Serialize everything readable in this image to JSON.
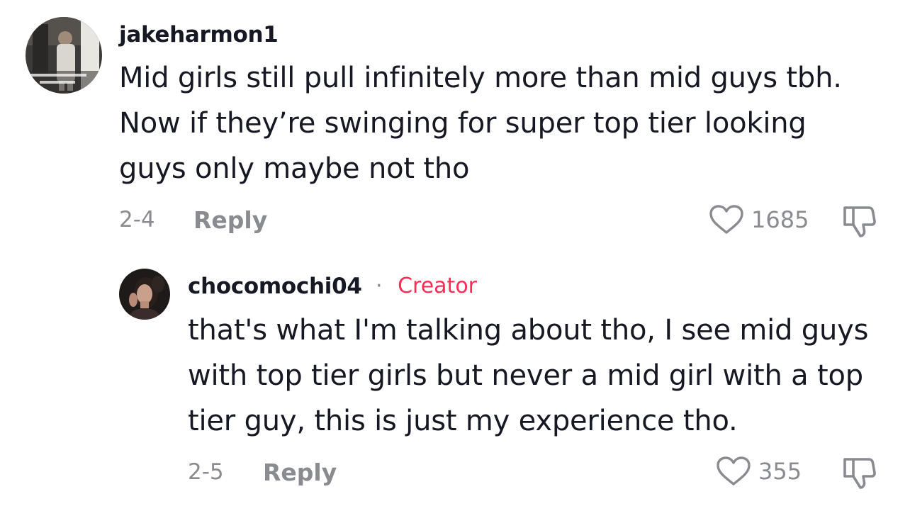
{
  "comments": [
    {
      "username": "jakeharmon1",
      "avatar_icon": "profile-photo-avatar",
      "text_lines": [
        "Mid girls still pull infinitely more than mid guys tbh.",
        "Now if they’re swinging for super top tier looking",
        "guys only maybe not tho"
      ],
      "date": "2-4",
      "reply_label": "Reply",
      "likes": "1685",
      "like_icon": "heart-outline-icon",
      "dislike_icon": "thumbs-down-outline-icon"
    }
  ],
  "replies": [
    {
      "username": "chocomochi04",
      "separator": "·",
      "badge": "Creator",
      "avatar_icon": "profile-photo-avatar",
      "text_lines": [
        "that's what I'm talking about tho, I see mid guys",
        "with top tier girls but never a mid girl with a top",
        "tier guy, this is just my experience tho."
      ],
      "date": "2-5",
      "reply_label": "Reply",
      "likes": "355",
      "like_icon": "heart-outline-icon",
      "dislike_icon": "thumbs-down-outline-icon"
    }
  ],
  "colors": {
    "text_primary": "#161823",
    "text_secondary": "#8a8b91",
    "creator_badge": "#fe2c55",
    "background": "#ffffff"
  }
}
